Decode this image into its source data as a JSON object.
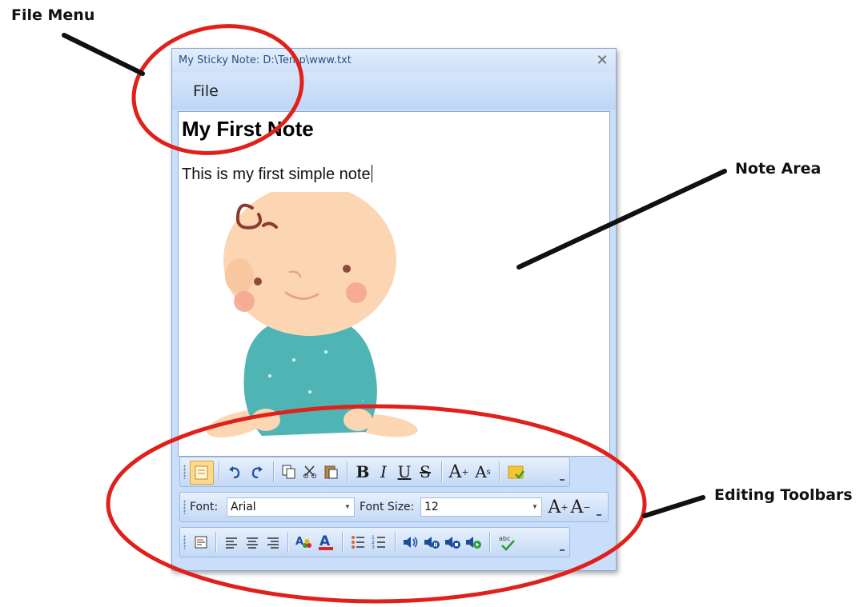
{
  "callouts": {
    "file_menu": "File Menu",
    "note_area": "Note Area",
    "editing_toolbars": "Editing Toolbars"
  },
  "window": {
    "title": "My Sticky Note: D:\\Temp\\www.txt",
    "close_glyph": "✕",
    "menu": {
      "file_label": "File"
    }
  },
  "note": {
    "heading": "My First Note",
    "body": "This is my first simple note"
  },
  "toolbar_format": {
    "font_label": "Font:",
    "font_value": "Arial",
    "size_label": "Font Size:",
    "size_value": "12"
  },
  "icons": {
    "toolbar1": [
      "notes-icon",
      "undo-icon",
      "redo-icon",
      "copy-icon",
      "cut-icon",
      "paste-icon",
      "bold-icon",
      "italic-icon",
      "underline-icon",
      "strikethrough-icon",
      "superscript-icon",
      "subscript-icon",
      "sticky-note-icon"
    ],
    "toolbar3": [
      "align-left-icon",
      "align-left-text-icon",
      "align-center-icon",
      "align-right-icon",
      "highlight-color-icon",
      "font-color-icon",
      "bullets-icon",
      "numbering-icon",
      "speak-icon",
      "speak-pause-icon",
      "speak-stop-icon",
      "speak-record-icon",
      "spell-check-icon"
    ]
  },
  "colors": {
    "window_bg": "#c9defa",
    "annotation_red": "#e0201a",
    "title_text": "#2b4e86"
  }
}
